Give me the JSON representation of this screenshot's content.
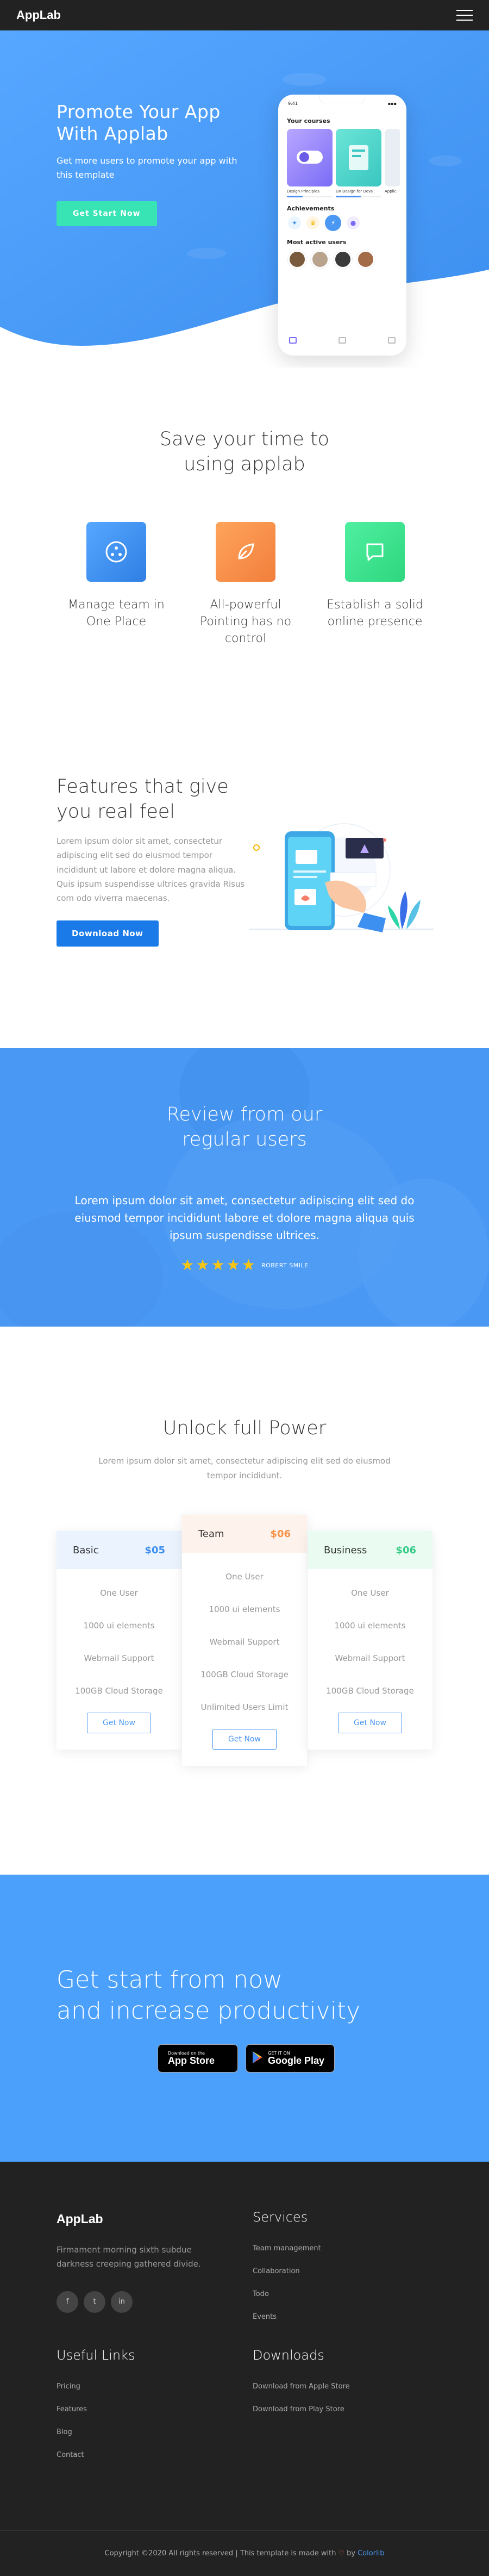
{
  "nav": {
    "logo": "AppLab"
  },
  "hero": {
    "title": "Promote Your App With Applab",
    "subtitle": "Get more users to promote your app with this template",
    "button": "Get Start Now"
  },
  "phone": {
    "time": "9:41",
    "courses_heading": "Your courses",
    "course1": "Design Principles",
    "course2": "UX Design for Devs",
    "course3": "Applic",
    "course1_progress": 0.35,
    "course2_progress": 0.55,
    "achievements_heading": "Achievements",
    "users_heading": "Most active users"
  },
  "save": {
    "title": "Save your time to\nusing applab",
    "items": [
      {
        "label": "Manage team in One Place",
        "icon": "team-icon",
        "color": "#3d8ff0"
      },
      {
        "label": "All-powerful Pointing has no control",
        "icon": "leaf-icon",
        "color": "#f6924b"
      },
      {
        "label": "Establish a solid online presence",
        "icon": "chat-icon",
        "color": "#3ee590"
      }
    ]
  },
  "features": {
    "title": "Features that give you real feel",
    "body": "Lorem ipsum dolor sit amet, consectetur adipiscing elit sed do eiusmod tempor incididunt ut labore et dolore magna aliqua. Quis ipsum suspendisse ultrices gravida Risus com odo viverra maecenas.",
    "button": "Download Now"
  },
  "review": {
    "title": "Review from our\nregular users",
    "body": "Lorem ipsum dolor sit amet, consectetur adipiscing elit sed do eiusmod tempor incididunt labore et dolore magna aliqua quis ipsum suspendisse ultrices.",
    "rating": 5,
    "reviewer": "ROBERT SMILE"
  },
  "pricing": {
    "title": "Unlock full Power",
    "subtitle": "Lorem ipsum dolor sit amet, consectetur adipiscing elit sed do eiusmod tempor incididunt.",
    "plans": [
      {
        "name": "Basic",
        "price": "$05",
        "color": "#3d8ff0",
        "bg": "#eaf3fe",
        "features": [
          "One User",
          "1000 ui elements",
          "Webmail Support",
          "100GB Cloud Storage"
        ],
        "button": "Get Now"
      },
      {
        "name": "Team",
        "price": "$06",
        "color": "#f6924b",
        "bg": "#fef3ec",
        "features": [
          "One User",
          "1000 ui elements",
          "Webmail Support",
          "100GB Cloud Storage",
          "Unlimited Users Limit"
        ],
        "button": "Get Now"
      },
      {
        "name": "Business",
        "price": "$06",
        "color": "#35cc87",
        "bg": "#eafbf2",
        "features": [
          "One User",
          "1000 ui elements",
          "Webmail Support",
          "100GB Cloud Storage"
        ],
        "button": "Get Now"
      }
    ]
  },
  "cta": {
    "title": "Get start from now\nand increase productivity",
    "appstore_small": "Download on the",
    "appstore_big": "App Store",
    "play_small": "GET IT ON",
    "play_big": "Google Play"
  },
  "footer": {
    "logo": "AppLab",
    "desc": "Firmament morning sixth subdue darkness creeping gathered divide.",
    "socials": [
      "f",
      "t",
      "in"
    ],
    "services_heading": "Services",
    "services": [
      "Team management",
      "Collaboration",
      "Todo",
      "Events"
    ],
    "useful_heading": "Useful Links",
    "useful": [
      "Pricing",
      "Features",
      "Blog",
      "Contact"
    ],
    "downloads_heading": "Downloads",
    "downloads": [
      "Download from Apple Store",
      "Download from Play Store"
    ],
    "copyright_pre": "Copyright ©2020 All rights reserved | This template is made with",
    "copyright_by": "by",
    "copyright_link": "Colorlib"
  },
  "colors": {
    "primary": "#4a98f4",
    "green": "#38e3b4",
    "dark": "#222222"
  }
}
